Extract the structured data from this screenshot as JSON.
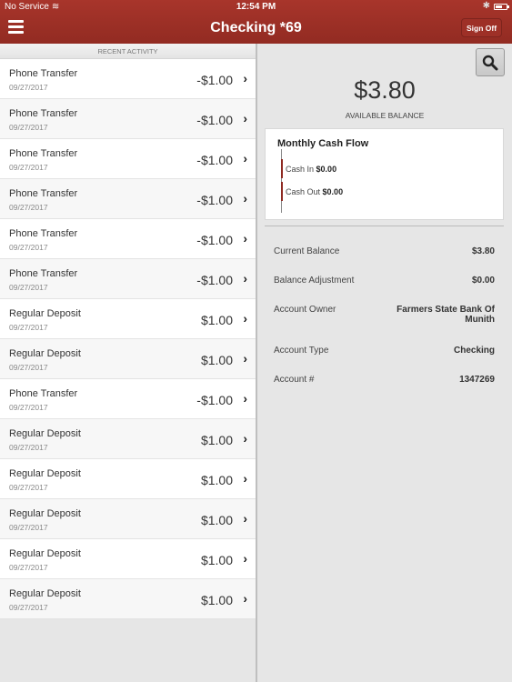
{
  "status_bar": {
    "carrier": "No Service",
    "time": "12:54 PM",
    "bluetooth": "✱"
  },
  "header": {
    "title": "Checking *69",
    "sign_off_label": "Sign Off"
  },
  "recent": {
    "header": "RECENT ACTIVITY",
    "items": [
      {
        "desc": "Phone Transfer",
        "date": "09/27/2017",
        "amount": "-$1.00"
      },
      {
        "desc": "Phone Transfer",
        "date": "09/27/2017",
        "amount": "-$1.00"
      },
      {
        "desc": "Phone Transfer",
        "date": "09/27/2017",
        "amount": "-$1.00"
      },
      {
        "desc": "Phone Transfer",
        "date": "09/27/2017",
        "amount": "-$1.00"
      },
      {
        "desc": "Phone Transfer",
        "date": "09/27/2017",
        "amount": "-$1.00"
      },
      {
        "desc": "Phone Transfer",
        "date": "09/27/2017",
        "amount": "-$1.00"
      },
      {
        "desc": "Regular Deposit",
        "date": "09/27/2017",
        "amount": "$1.00"
      },
      {
        "desc": "Regular Deposit",
        "date": "09/27/2017",
        "amount": "$1.00"
      },
      {
        "desc": "Phone Transfer",
        "date": "09/27/2017",
        "amount": "-$1.00"
      },
      {
        "desc": "Regular Deposit",
        "date": "09/27/2017",
        "amount": "$1.00"
      },
      {
        "desc": "Regular Deposit",
        "date": "09/27/2017",
        "amount": "$1.00"
      },
      {
        "desc": "Regular Deposit",
        "date": "09/27/2017",
        "amount": "$1.00"
      },
      {
        "desc": "Regular Deposit",
        "date": "09/27/2017",
        "amount": "$1.00"
      },
      {
        "desc": "Regular Deposit",
        "date": "09/27/2017",
        "amount": "$1.00"
      }
    ]
  },
  "account": {
    "available_balance": "$3.80",
    "available_balance_label": "AVAILABLE BALANCE",
    "cash_flow": {
      "title": "Monthly Cash Flow",
      "cash_in_label": "Cash In",
      "cash_in_value": "$0.00",
      "cash_out_label": "Cash Out",
      "cash_out_value": "$0.00"
    },
    "details": [
      {
        "label": "Current Balance",
        "value": "$3.80"
      },
      {
        "label": "Balance Adjustment",
        "value": "$0.00"
      },
      {
        "label": "Account Owner",
        "value": "Farmers State Bank Of Munith"
      },
      {
        "label": "Account Type",
        "value": "Checking"
      },
      {
        "label": "Account #",
        "value": "1347269"
      }
    ]
  },
  "colors": {
    "brand": "#9e3027",
    "cashflow_bar": "#8e2a22"
  }
}
